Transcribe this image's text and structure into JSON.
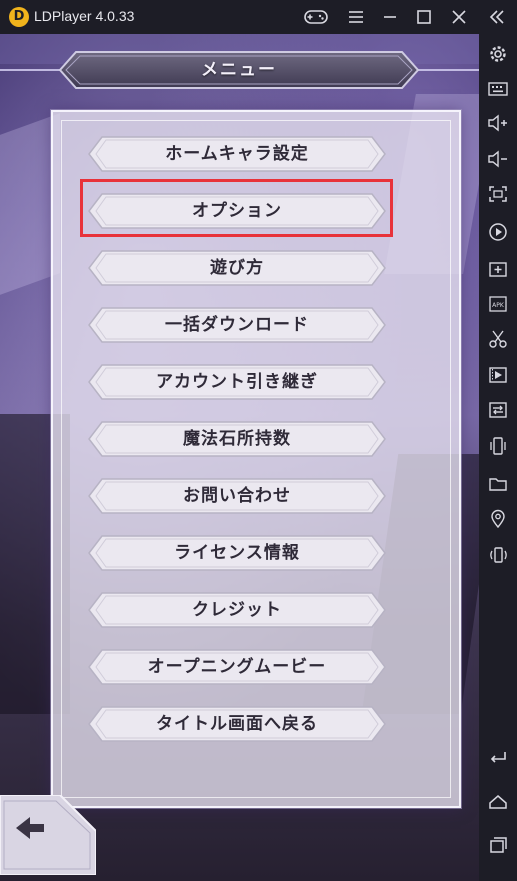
{
  "titlebar": {
    "app_name": "LDPlayer 4.0.33",
    "logo_glyph": "D",
    "icons": [
      "gamepad-icon",
      "menu-icon",
      "minimize-icon",
      "maximize-icon",
      "close-icon",
      "collapse-icon"
    ]
  },
  "sidebar": {
    "icons": [
      "settings-icon",
      "keyboard-icon",
      "volume-up-icon",
      "volume-down-icon",
      "screenshot-icon",
      "record-icon",
      "add-app-icon",
      "apk-icon",
      "scissors-icon",
      "video-icon",
      "sync-icon",
      "shake-icon",
      "folder-icon",
      "location-icon",
      "rotate-icon",
      "back-icon",
      "home-icon",
      "recent-apps-icon"
    ],
    "apk_label": "APK"
  },
  "game": {
    "title": "メニュー",
    "menu_items": [
      "ホームキャラ設定",
      "オプション",
      "遊び方",
      "一括ダウンロード",
      "アカウント引き継ぎ",
      "魔法石所持数",
      "お問い合わせ",
      "ライセンス情報",
      "クレジット",
      "オープニングムービー",
      "タイトル画面へ戻る"
    ],
    "highlighted_item": "オプション"
  },
  "colors": {
    "highlight": "#e8323a",
    "logo": "#f0b31c",
    "chrome": "#1d1d26"
  }
}
